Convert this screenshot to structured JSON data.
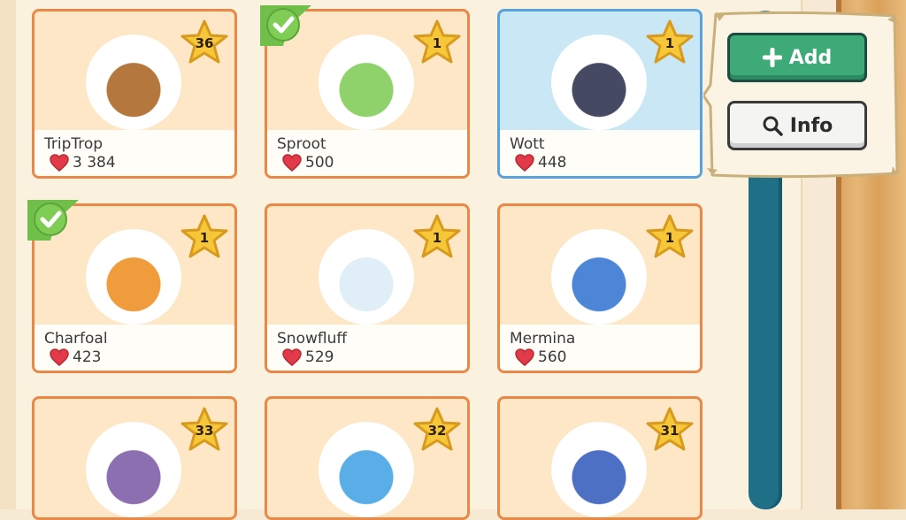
{
  "creatures": [
    {
      "name": "TripTrop",
      "votes": "3 384",
      "level": "36",
      "owned": false,
      "selected": false,
      "color": "#b4773d"
    },
    {
      "name": "Sproot",
      "votes": "500",
      "level": "1",
      "owned": true,
      "selected": false,
      "color": "#8fd16a"
    },
    {
      "name": "Wott",
      "votes": "448",
      "level": "1",
      "owned": false,
      "selected": true,
      "color": "#454a62"
    },
    {
      "name": "Charfoal",
      "votes": "423",
      "level": "1",
      "owned": true,
      "selected": false,
      "color": "#f09b3c"
    },
    {
      "name": "Snowfluff",
      "votes": "529",
      "level": "1",
      "owned": false,
      "selected": false,
      "color": "#dfeef7"
    },
    {
      "name": "Mermina",
      "votes": "560",
      "level": "1",
      "owned": false,
      "selected": false,
      "color": "#4d86d7"
    },
    {
      "name": "",
      "votes": "",
      "level": "33",
      "owned": false,
      "selected": false,
      "color": "#8b6fb0"
    },
    {
      "name": "",
      "votes": "",
      "level": "32",
      "owned": false,
      "selected": false,
      "color": "#5aaee8"
    },
    {
      "name": "",
      "votes": "",
      "level": "31",
      "owned": false,
      "selected": false,
      "color": "#4d6fc4"
    }
  ],
  "popup": {
    "add_label": "Add",
    "info_label": "Info"
  },
  "icons": {
    "vote": "heart-icon",
    "level": "star-icon",
    "owned": "checkmark-icon",
    "add": "plus-icon",
    "info": "magnifier-icon"
  },
  "colors": {
    "card_border": "#ea8847",
    "selected_border": "#5aa2dc",
    "add_button": "#3daa78",
    "heart": "#e23a48",
    "star": "#f7c73a",
    "check": "#6fbf4a"
  }
}
